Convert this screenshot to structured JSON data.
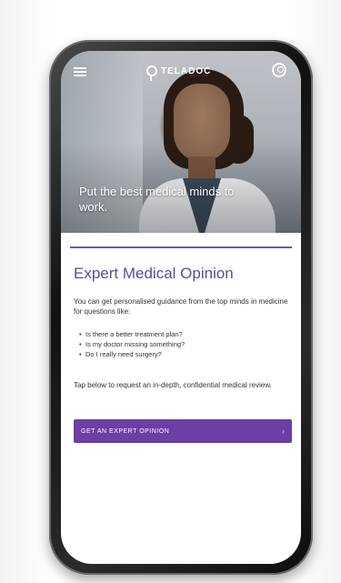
{
  "app": {
    "brand": "TELADOC"
  },
  "hero": {
    "caption": "Put the best medical minds to work."
  },
  "content": {
    "title": "Expert Medical Opinion",
    "intro": "You can get personalised guidance from the top minds in medicine for questions like:",
    "bullets": [
      "Is there a better treatment plan?",
      "Is my doctor missing something?",
      "Do I really need surgery?"
    ],
    "tap_text": "Tap below to request an in-depth, confidential medical review.",
    "cta_label": "GET AN EXPERT OPINION",
    "cta_arrow": "›"
  },
  "icons": {
    "menu": "hamburger-menu-icon",
    "account": "user-account-icon",
    "logo": "teladoc-logo-icon",
    "arrow": "chevron-right-icon"
  },
  "colors": {
    "accent": "#5b4aa0",
    "cta": "#6b3fa5"
  }
}
